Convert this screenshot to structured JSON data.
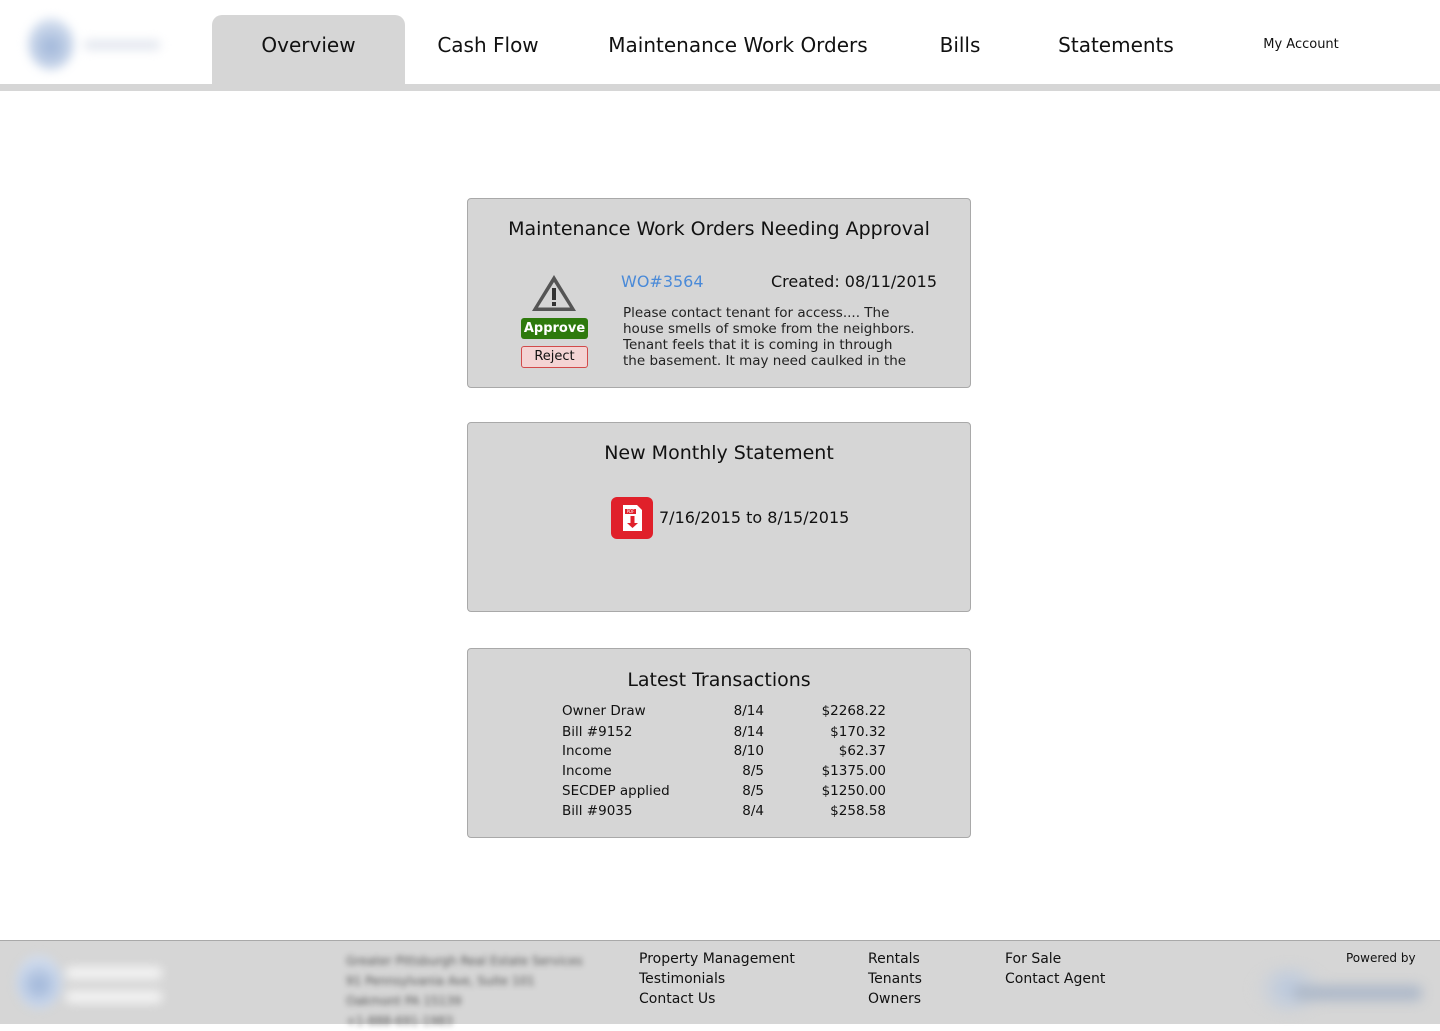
{
  "header": {
    "tabs": [
      {
        "label": "Overview",
        "active": true
      },
      {
        "label": "Cash Flow"
      },
      {
        "label": "Maintenance Work Orders"
      },
      {
        "label": "Bills"
      },
      {
        "label": "Statements"
      }
    ],
    "account_label": "My Account"
  },
  "work_orders": {
    "title": "Maintenance Work Orders Needing Approval",
    "wo_number": "WO#3564",
    "created": "Created: 08/11/2015",
    "description": "Please contact tenant for access.... The house smells of smoke from the neighbors. Tenant feels that it is coming in through the basement. It may need caulked in the",
    "approve_label": "Approve",
    "reject_label": "Reject",
    "icon": "warning-triangle-icon"
  },
  "statement": {
    "title": "New Monthly Statement",
    "range": "7/16/2015 to 8/15/2015",
    "icon": "pdf-download-icon",
    "icon_color": "#e0202a"
  },
  "transactions": {
    "title": "Latest Transactions",
    "rows": [
      {
        "desc": "Owner Draw",
        "date": "8/14",
        "amount": "$2268.22"
      },
      {
        "desc": "Bill #9152",
        "date": "8/14",
        "amount": "$170.32"
      },
      {
        "desc": "Income",
        "date": "8/10",
        "amount": "$62.37"
      },
      {
        "desc": "Income",
        "date": "8/5",
        "amount": "$1375.00"
      },
      {
        "desc": "SECDEP applied",
        "date": "8/5",
        "amount": "$1250.00"
      },
      {
        "desc": "Bill #9035",
        "date": "8/4",
        "amount": "$258.58"
      }
    ]
  },
  "footer": {
    "address_lines": [
      "Greater Pittsburgh Real Estate Services",
      "91 Pennsylvania Ave, Suite 101",
      "Oakmont PA 15139",
      "+1-888-691-1983"
    ],
    "col1": [
      "Property Management",
      "Testimonials",
      "Contact Us"
    ],
    "col2": [
      "Rentals",
      "Tenants",
      "Owners"
    ],
    "col3": [
      "For Sale",
      "Contact Agent"
    ],
    "powered_by": "Powered by"
  },
  "colors": {
    "card_bg": "#d6d6d6",
    "link": "#4a8ad8",
    "approve": "#2e7a0d",
    "reject_border": "#d24a4a"
  }
}
